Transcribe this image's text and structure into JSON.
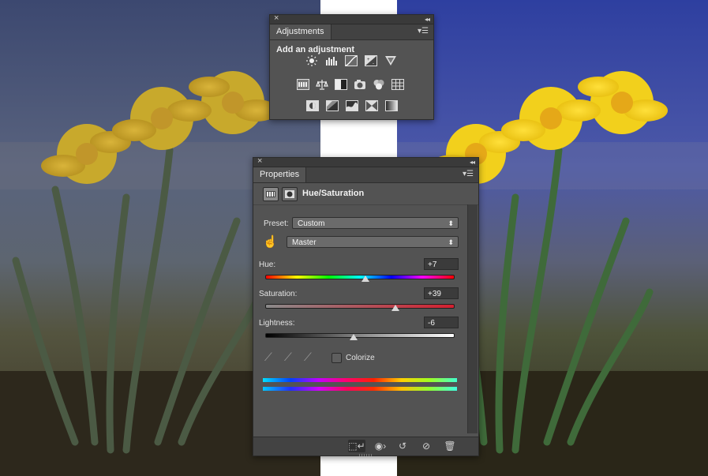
{
  "adjustments_panel": {
    "tab": "Adjustments",
    "heading": "Add an adjustment",
    "rows": [
      [
        "brightness-contrast-icon",
        "levels-icon",
        "curves-icon",
        "exposure-icon",
        "vibrance-icon"
      ],
      [
        "hue-saturation-icon",
        "color-balance-icon",
        "black-white-icon",
        "photo-filter-icon",
        "channel-mixer-icon",
        "color-lookup-icon"
      ],
      [
        "invert-icon",
        "posterize-icon",
        "threshold-icon",
        "selective-color-icon",
        "gradient-map-icon"
      ]
    ]
  },
  "properties_panel": {
    "tab": "Properties",
    "title": "Hue/Saturation",
    "preset_label": "Preset:",
    "preset_value": "Custom",
    "channel_value": "Master",
    "hue": {
      "label": "Hue:",
      "value": "+7",
      "level": 0.535
    },
    "saturation": {
      "label": "Saturation:",
      "value": "+39",
      "level": 0.695
    },
    "lightness": {
      "label": "Lightness:",
      "value": "-6",
      "level": 0.47
    },
    "colorize_label": "Colorize",
    "bottom_buttons": [
      "clip-to-layer-icon",
      "view-previous-icon",
      "reset-icon",
      "visibility-icon",
      "trash-icon"
    ]
  }
}
